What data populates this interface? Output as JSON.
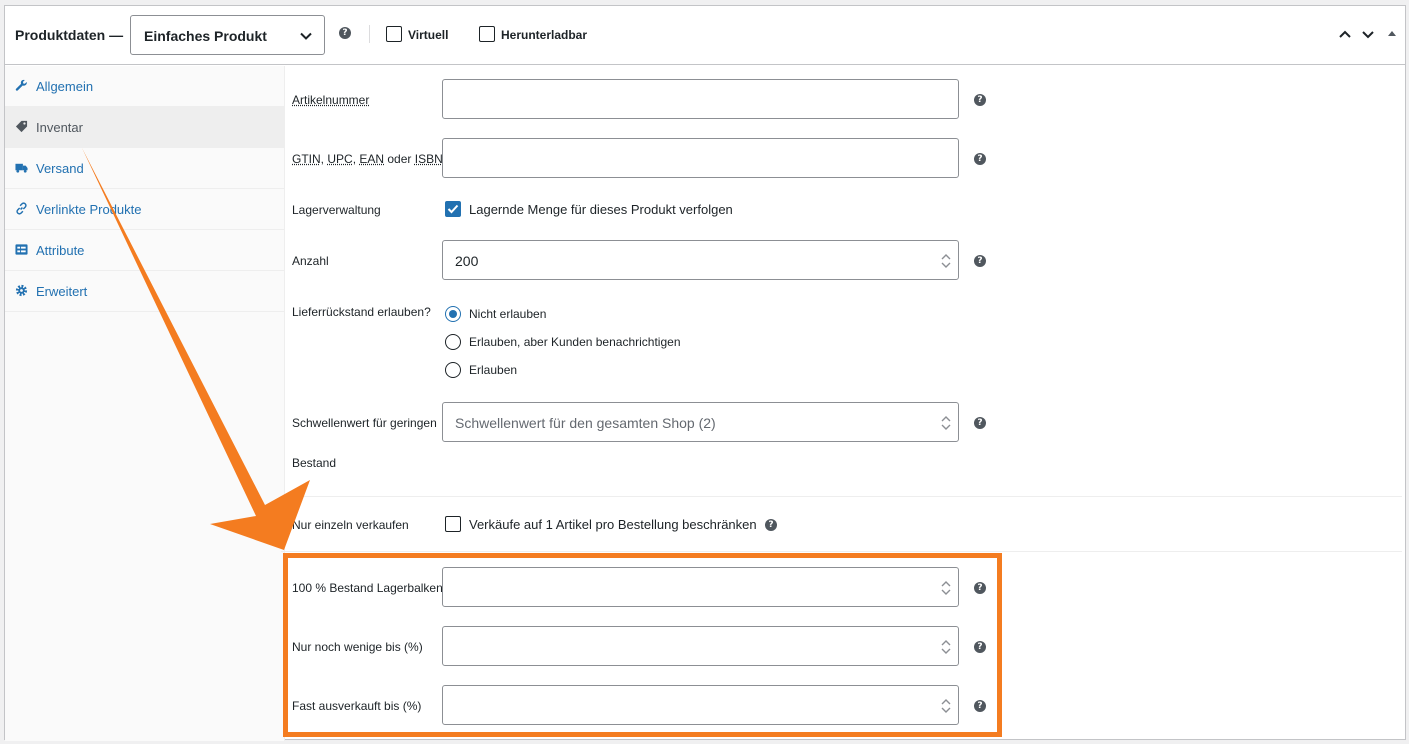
{
  "header": {
    "title": "Produktdaten —",
    "product_type": "Einfaches Produkt",
    "virtual_label": "Virtuell",
    "downloadable_label": "Herunterladbar"
  },
  "sidebar": {
    "items": [
      {
        "label": "Allgemein",
        "icon": "wrench-icon"
      },
      {
        "label": "Inventar",
        "icon": "tag-icon",
        "active": true
      },
      {
        "label": "Versand",
        "icon": "truck-icon"
      },
      {
        "label": "Verlinkte Produkte",
        "icon": "link-icon"
      },
      {
        "label": "Attribute",
        "icon": "list-icon"
      },
      {
        "label": "Erweitert",
        "icon": "gear-icon"
      }
    ]
  },
  "inventory": {
    "sku_label": "Artikelnummer",
    "sku_value": "",
    "gtin_label_parts": [
      "GTIN",
      ", ",
      "UPC",
      ", ",
      "EAN",
      " oder ",
      "ISBN"
    ],
    "gtin_value": "",
    "stock_mgmt_label": "Lagerverwaltung",
    "stock_mgmt_checkbox_label": "Lagernde Menge für dieses Produkt verfolgen",
    "quantity_label": "Anzahl",
    "quantity_value": "200",
    "backorders_label": "Lieferrückstand erlauben?",
    "backorder_options": [
      "Nicht erlauben",
      "Erlauben, aber Kunden benachrichtigen",
      "Erlauben"
    ],
    "backorder_selected": "Nicht erlauben",
    "low_stock_label_line1": "Schwellenwert für geringen",
    "low_stock_label_line2": "Bestand",
    "low_stock_placeholder": "Schwellenwert für den gesamten Shop (2)",
    "sold_individually_label": "Nur einzeln verkaufen",
    "sold_individually_checkbox_label": "Verkäufe auf 1 Artikel pro Bestellung beschränken",
    "stock_bar_label": "100 % Bestand Lagerbalken",
    "few_left_label": "Nur noch wenige bis (%)",
    "almost_sold_out_label": "Fast ausverkauft bis (%)"
  },
  "colors": {
    "accent": "#2271b1",
    "annotation": "#f47c20"
  }
}
